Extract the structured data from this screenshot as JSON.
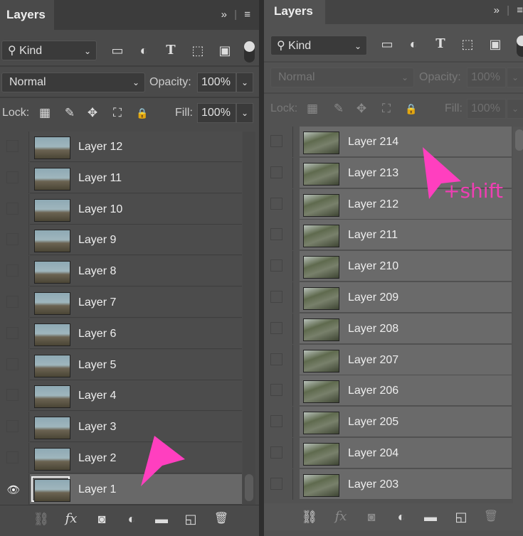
{
  "accent_color": "#ff3fbf",
  "left_panel": {
    "title": "Layers",
    "filter": {
      "label": "Kind"
    },
    "blend_mode": "Normal",
    "opacity_label": "Opacity:",
    "opacity_value": "100%",
    "lock_label": "Lock:",
    "fill_label": "Fill:",
    "fill_value": "100%",
    "layers": [
      {
        "name": "Layer 12",
        "visible": false,
        "selected": false
      },
      {
        "name": "Layer 11",
        "visible": false,
        "selected": false
      },
      {
        "name": "Layer 10",
        "visible": false,
        "selected": false
      },
      {
        "name": "Layer 9",
        "visible": false,
        "selected": false
      },
      {
        "name": "Layer 8",
        "visible": false,
        "selected": false
      },
      {
        "name": "Layer 7",
        "visible": false,
        "selected": false
      },
      {
        "name": "Layer 6",
        "visible": false,
        "selected": false
      },
      {
        "name": "Layer 5",
        "visible": false,
        "selected": false
      },
      {
        "name": "Layer 4",
        "visible": false,
        "selected": false
      },
      {
        "name": "Layer 3",
        "visible": false,
        "selected": false
      },
      {
        "name": "Layer 2",
        "visible": false,
        "selected": false
      },
      {
        "name": "Layer 1",
        "visible": true,
        "selected": true
      }
    ]
  },
  "right_panel": {
    "title": "Layers",
    "filter": {
      "label": "Kind"
    },
    "blend_mode": "Normal",
    "opacity_label": "Opacity:",
    "opacity_value": "100%",
    "lock_label": "Lock:",
    "fill_label": "Fill:",
    "fill_value": "100%",
    "annotation": "+shift",
    "layers": [
      {
        "name": "Layer 214",
        "visible": false,
        "selected": true
      },
      {
        "name": "Layer 213",
        "visible": false,
        "selected": true
      },
      {
        "name": "Layer 212",
        "visible": false,
        "selected": true
      },
      {
        "name": "Layer 211",
        "visible": false,
        "selected": true
      },
      {
        "name": "Layer 210",
        "visible": false,
        "selected": true
      },
      {
        "name": "Layer 209",
        "visible": false,
        "selected": true
      },
      {
        "name": "Layer 208",
        "visible": false,
        "selected": true
      },
      {
        "name": "Layer 207",
        "visible": false,
        "selected": true
      },
      {
        "name": "Layer 206",
        "visible": false,
        "selected": true
      },
      {
        "name": "Layer 205",
        "visible": false,
        "selected": true
      },
      {
        "name": "Layer 204",
        "visible": false,
        "selected": true
      },
      {
        "name": "Layer 203",
        "visible": false,
        "selected": true
      }
    ]
  },
  "icons": {
    "collapse": "»",
    "menu": "≡",
    "search": "⚲",
    "chevron": "⌄",
    "filter_pixel": "▭",
    "filter_adjust": "◐",
    "filter_type": "T",
    "filter_shape": "⬚",
    "filter_smart": "▣",
    "lock_transparent": "▦",
    "lock_paint": "✎",
    "lock_move": "✥",
    "lock_artboard": "⛶",
    "lock_all": "🔒",
    "eye": "👁",
    "link": "⛓",
    "fx": "fx",
    "mask": "◙",
    "adjustment": "◐",
    "group": "▬",
    "new_layer": "◱",
    "delete": "🗑"
  }
}
